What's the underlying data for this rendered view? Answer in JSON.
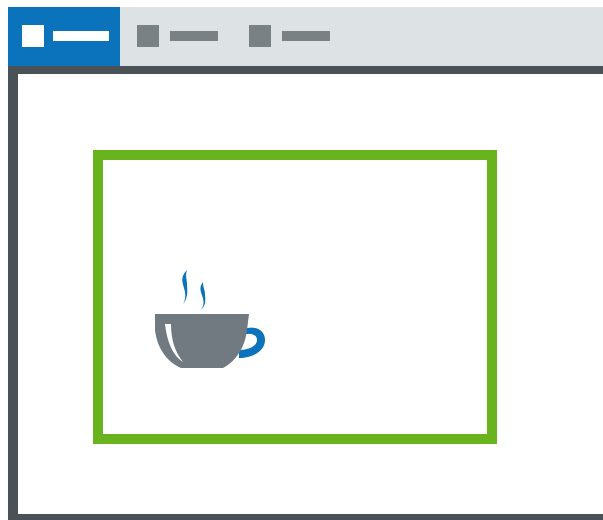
{
  "window": {
    "tabs": [
      {
        "state": "active",
        "icon": "page-icon",
        "label_placeholder": ""
      },
      {
        "state": "inactive",
        "icon": "page-icon",
        "label_placeholder": ""
      },
      {
        "state": "inactive",
        "icon": "page-icon",
        "label_placeholder": ""
      }
    ]
  },
  "content": {
    "focus_region": {
      "highlight": true
    },
    "app_icon": {
      "name": "coffee-cup-icon"
    }
  },
  "colors": {
    "active_tab": "#0a73bb",
    "tab_strip": "#dde2e4",
    "inactive_tab_glyph": "#7a8185",
    "window_border": "#4b5257",
    "highlight_border": "#68b31e",
    "cup_body": "#717a80",
    "cup_accent": "#0a73bb"
  }
}
